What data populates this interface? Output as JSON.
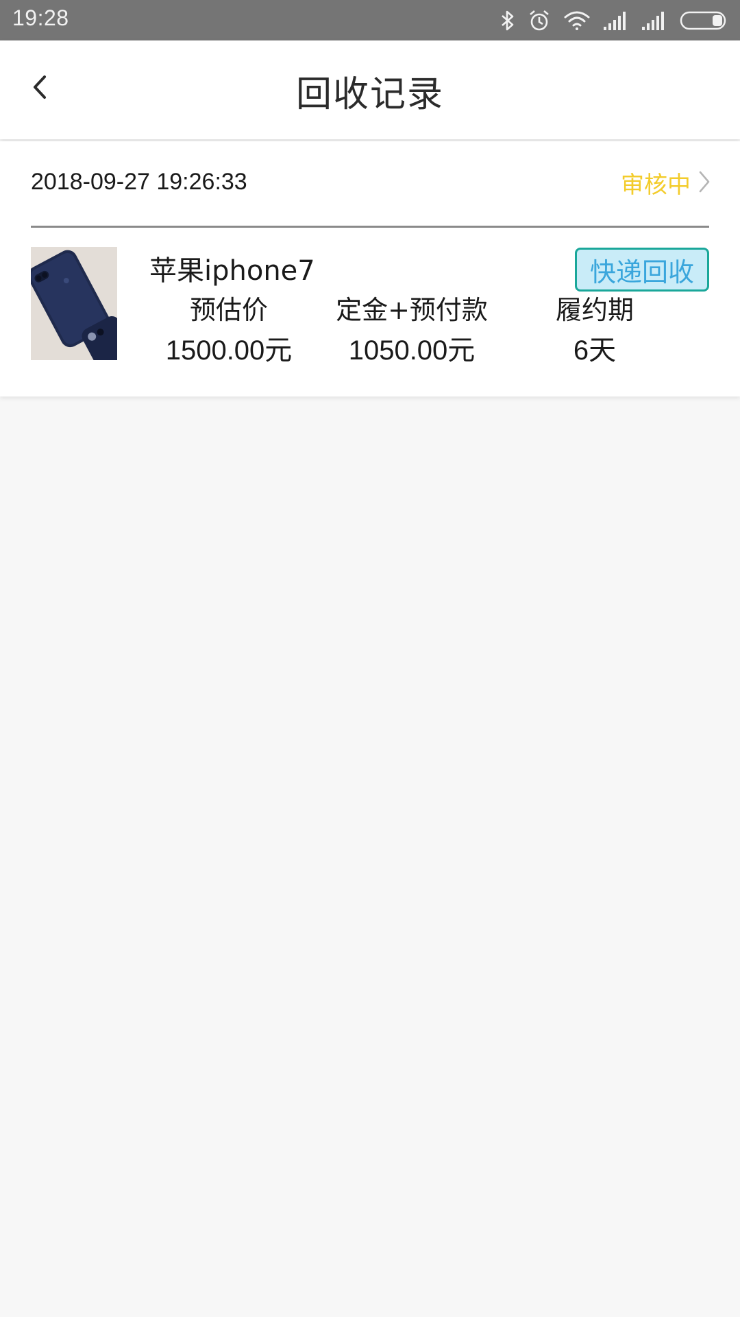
{
  "status_bar": {
    "time": "19:28",
    "icons": [
      "bluetooth-icon",
      "alarm-icon",
      "wifi-icon",
      "signal-icon",
      "signal-icon",
      "battery-icon"
    ]
  },
  "header": {
    "title": "回收记录",
    "back_icon": "chevron-left-icon"
  },
  "record": {
    "datetime": "2018-09-27 19:26:33",
    "status": "审核中",
    "status_color": "#f3cc2b",
    "product_name": "苹果iphone7",
    "method": "快递回收",
    "stats": [
      {
        "label": "预估价",
        "value": "1500.00元"
      },
      {
        "label": "定金+预付款",
        "value": "1050.00元"
      },
      {
        "label": "履约期",
        "value": "6天"
      }
    ]
  },
  "colors": {
    "status_bar": "#757575",
    "background": "#f7f7f7",
    "badge_border": "#1aa79a",
    "badge_fill": "#c9ecf8",
    "badge_text": "#3aa6dc"
  }
}
